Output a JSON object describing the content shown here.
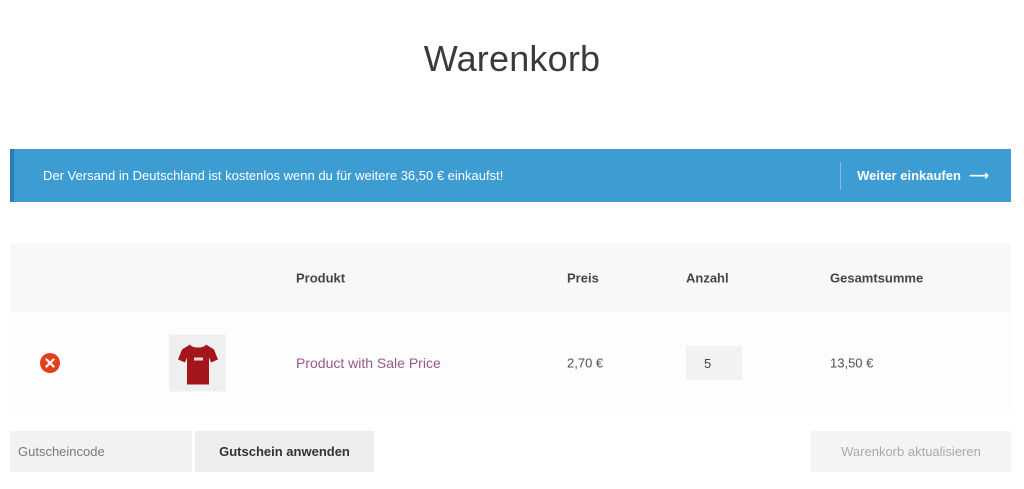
{
  "page": {
    "title": "Warenkorb"
  },
  "notice": {
    "text": "Der Versand in Deutschland ist kostenlos wenn du für weitere 36,50 € einkaufst!",
    "link_label": "Weiter einkaufen",
    "link_icon": "arrow-right-icon",
    "background_color": "#3d9cd2"
  },
  "table": {
    "headers": {
      "product": "Produkt",
      "price": "Preis",
      "quantity": "Anzahl",
      "total": "Gesamtsumme"
    },
    "rows": [
      {
        "remove_icon": "remove-x-icon",
        "thumbnail_icon": "tshirt-icon",
        "product": "Product with Sale Price",
        "price": "2,70 €",
        "quantity": "5",
        "total": "13,50 €"
      }
    ]
  },
  "coupon": {
    "placeholder": "Gutscheincode",
    "button_label": "Gutschein anwenden"
  },
  "update_button_label": "Warenkorb aktualisieren",
  "colors": {
    "remove": "#e2401c",
    "product_link": "#96588a"
  }
}
